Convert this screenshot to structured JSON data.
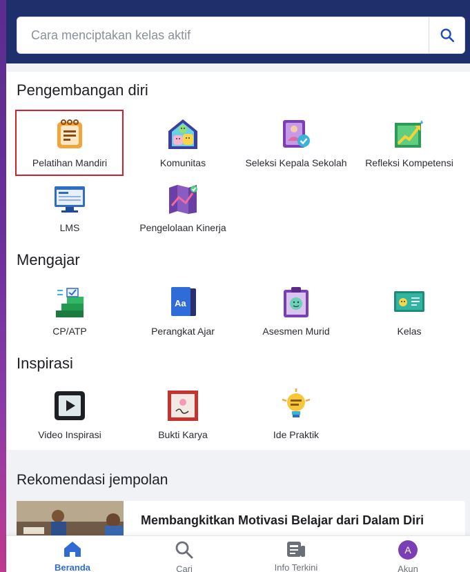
{
  "search": {
    "placeholder": "Cara menciptakan kelas aktif"
  },
  "sections": {
    "pengembangan": {
      "title": "Pengembangan diri",
      "items": [
        "Pelatihan Mandiri",
        "Komunitas",
        "Seleksi Kepala Sekolah",
        "Refleksi Kompetensi",
        "LMS",
        "Pengelolaan Kinerja"
      ]
    },
    "mengajar": {
      "title": "Mengajar",
      "items": [
        "CP/ATP",
        "Perangkat Ajar",
        "Asesmen Murid",
        "Kelas"
      ]
    },
    "inspirasi": {
      "title": "Inspirasi",
      "items": [
        "Video Inspirasi",
        "Bukti Karya",
        "Ide Praktik"
      ]
    }
  },
  "recommendation": {
    "title": "Rekomendasi jempolan",
    "card_title": "Membangkitkan Motivasi Belajar dari Dalam Diri"
  },
  "nav": {
    "items": [
      "Beranda",
      "Cari",
      "Info Terkini",
      "Akun"
    ],
    "avatar_letter": "A",
    "active": "Beranda"
  },
  "colors": {
    "header_bg": "#1f2f6b",
    "accent": "#2f6ad8",
    "highlight": "#d11f2a"
  }
}
